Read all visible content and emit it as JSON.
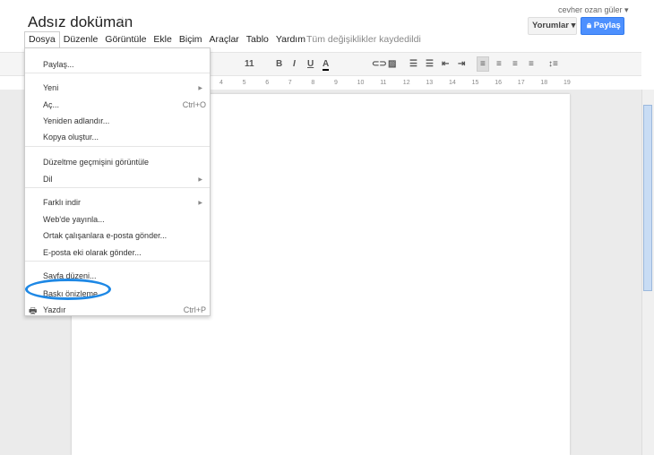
{
  "doc_title": "Adsız doküman",
  "user": "cevher ozan güler ▾",
  "comments_button": "Yorumlar ▾",
  "share_button": "Paylaş",
  "menubar": [
    "Dosya",
    "Düzenle",
    "Görüntüle",
    "Ekle",
    "Biçim",
    "Araçlar",
    "Tablo",
    "Yardım"
  ],
  "save_status": "Tüm değişiklikler kaydedildi",
  "toolbar": {
    "font_size": "11",
    "bold": "B",
    "italic": "I",
    "underline": "U",
    "text_color": "A"
  },
  "ruler": [
    "4",
    "5",
    "6",
    "7",
    "8",
    "9",
    "10",
    "11",
    "12",
    "13",
    "14",
    "15",
    "16",
    "17",
    "18",
    "19"
  ],
  "file_menu": {
    "items": [
      {
        "label": "Paylaş..."
      },
      {
        "label": "Yeni",
        "submenu": true
      },
      {
        "label": "Aç...",
        "shortcut": "Ctrl+O"
      },
      {
        "label": "Yeniden adlandır..."
      },
      {
        "label": "Kopya oluştur..."
      },
      {
        "label": "Düzeltme geçmişini görüntüle"
      },
      {
        "label": "Dil",
        "submenu": true
      },
      {
        "label": "Farklı indir",
        "submenu": true
      },
      {
        "label": "Web'de yayınla..."
      },
      {
        "label": "Ortak çalışanlara e-posta gönder..."
      },
      {
        "label": "E-posta eki olarak gönder..."
      },
      {
        "label": "Sayfa düzeni..."
      },
      {
        "label": "Baskı önizleme",
        "highlighted": true
      },
      {
        "label": "Yazdır",
        "shortcut": "Ctrl+P",
        "icon": "printer-icon"
      }
    ]
  },
  "colors": {
    "accent": "#4d90fe",
    "highlight_ellipse": "#1e88e5"
  }
}
